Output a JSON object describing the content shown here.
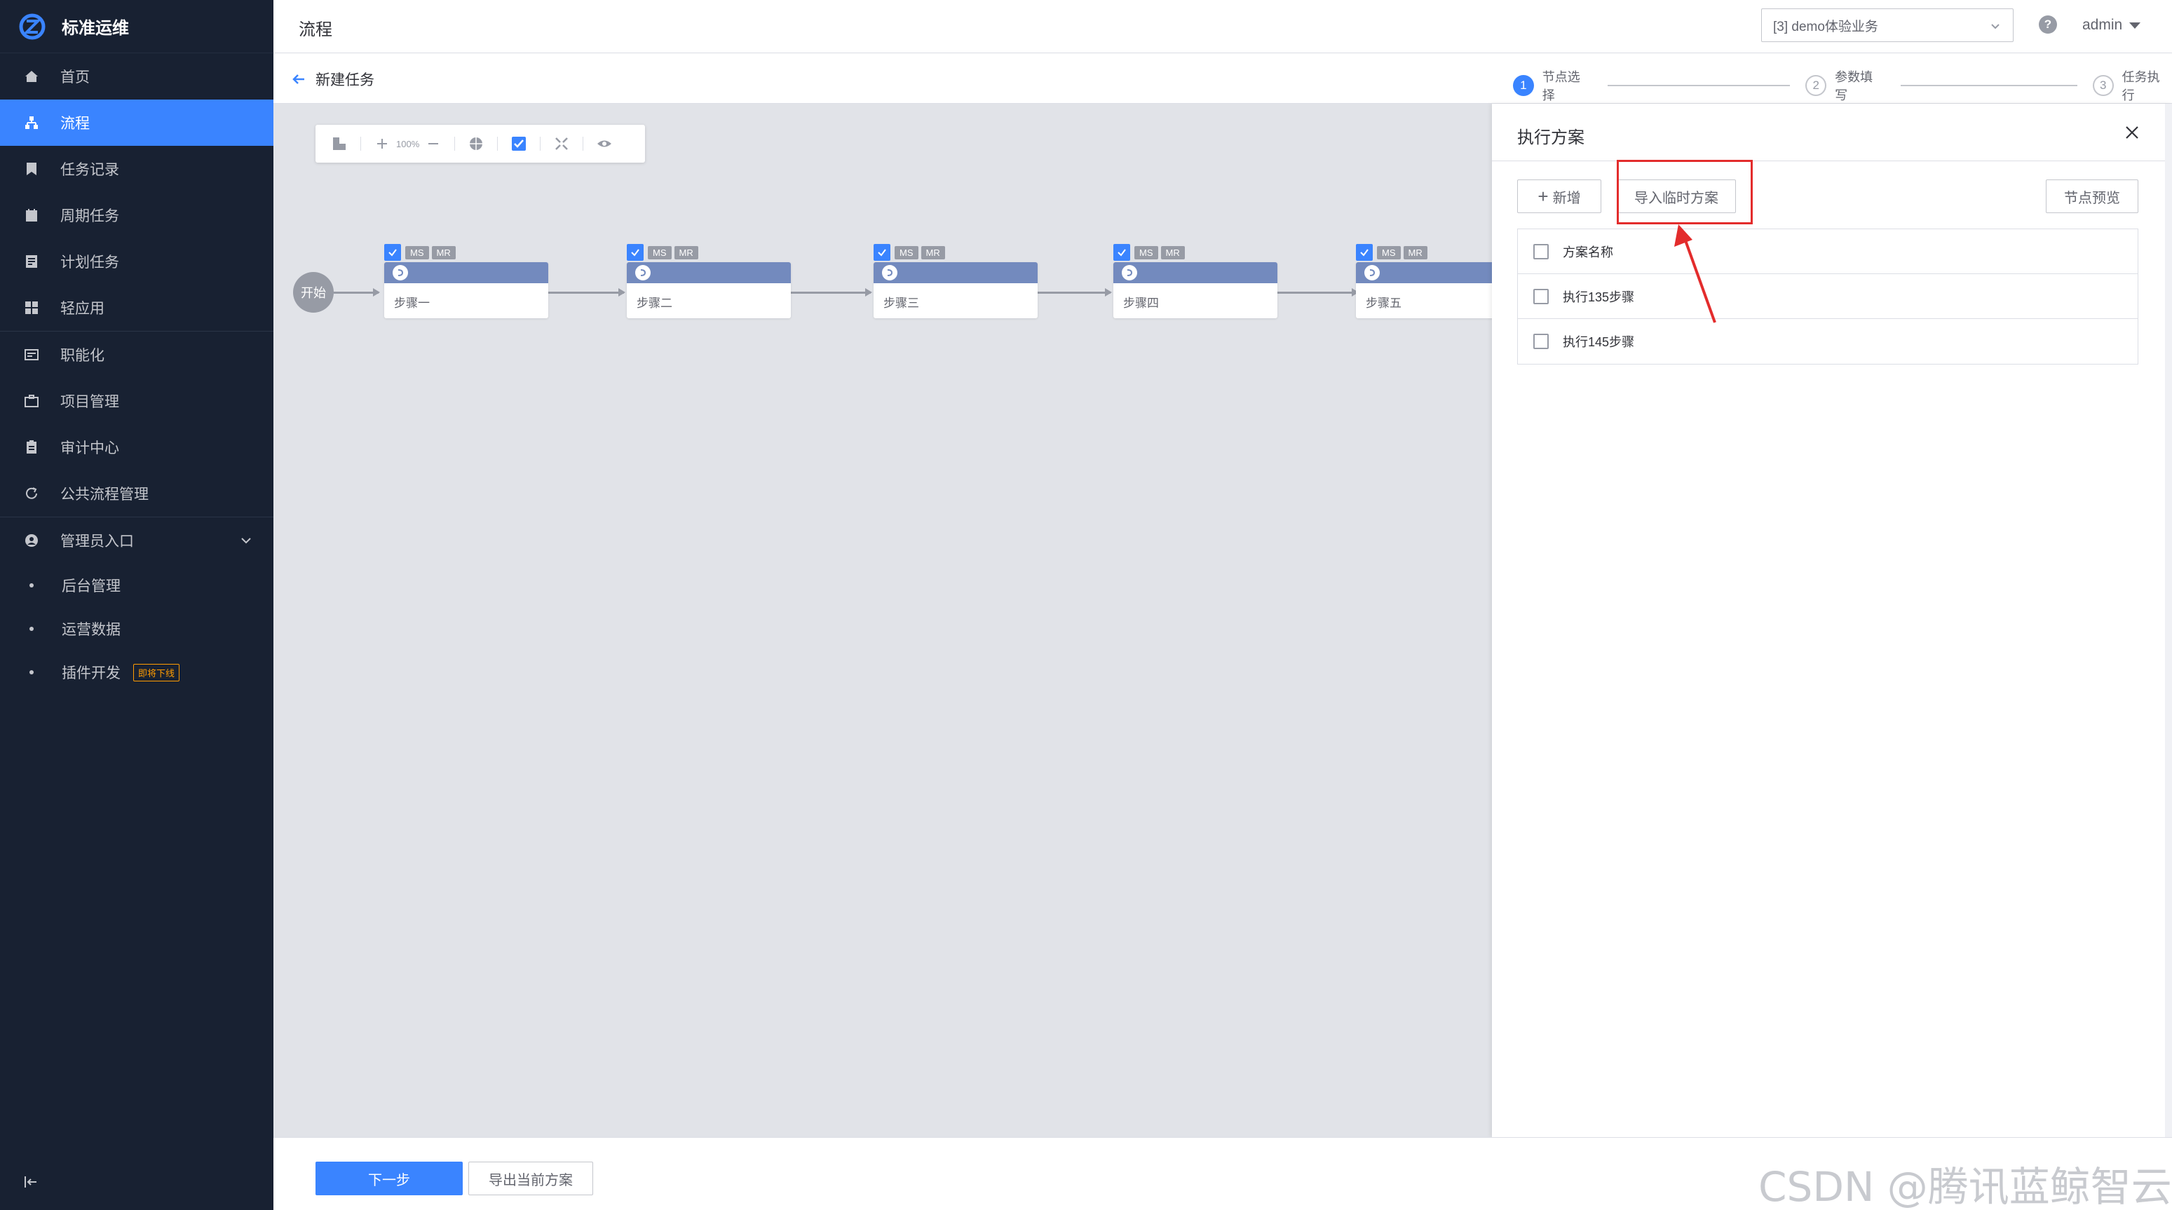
{
  "brand": {
    "title": "标准运维"
  },
  "sidebar": {
    "items": [
      {
        "label": "首页",
        "icon": "home-icon"
      },
      {
        "label": "流程",
        "icon": "flow-icon",
        "active": true
      },
      {
        "label": "任务记录",
        "icon": "bookmark-icon"
      },
      {
        "label": "周期任务",
        "icon": "calendar-icon"
      },
      {
        "label": "计划任务",
        "icon": "plan-icon"
      },
      {
        "label": "轻应用",
        "icon": "apps-icon"
      }
    ],
    "items2": [
      {
        "label": "职能化",
        "icon": "function-icon"
      },
      {
        "label": "项目管理",
        "icon": "briefcase-icon"
      },
      {
        "label": "审计中心",
        "icon": "clipboard-icon"
      },
      {
        "label": "公共流程管理",
        "icon": "refresh-icon"
      }
    ],
    "admin_group": {
      "label": "管理员入口",
      "icon": "user-circle-icon"
    },
    "admin_items": [
      {
        "label": "后台管理"
      },
      {
        "label": "运营数据"
      },
      {
        "label": "插件开发",
        "badge": "即将下线"
      }
    ]
  },
  "header": {
    "title": "流程",
    "business_select": "[3] demo体验业务",
    "user": "admin"
  },
  "subheader": {
    "back_label": "新建任务",
    "steps": [
      {
        "num": "1",
        "label": "节点选择",
        "active": true
      },
      {
        "num": "2",
        "label": "参数填写"
      },
      {
        "num": "3",
        "label": "任务执行"
      }
    ]
  },
  "canvas": {
    "zoom": "100%",
    "start_label": "开始",
    "tags": [
      "MS",
      "MR"
    ],
    "nodes": [
      {
        "label": "步骤一"
      },
      {
        "label": "步骤二"
      },
      {
        "label": "步骤三"
      },
      {
        "label": "步骤四"
      },
      {
        "label": "步骤五"
      }
    ]
  },
  "panel": {
    "title": "执行方案",
    "add_label": "新增",
    "import_label": "导入临时方案",
    "preview_label": "节点预览",
    "rows": [
      {
        "label": "方案名称"
      },
      {
        "label": "执行135步骤"
      },
      {
        "label": "执行145步骤"
      }
    ]
  },
  "footer": {
    "next_label": "下一步",
    "export_label": "导出当前方案"
  },
  "watermark": "CSDN @腾讯蓝鲸智云",
  "colors": {
    "accent": "#3a84ff",
    "sidebar_bg": "#182132",
    "node_header": "#738abe",
    "annotation": "#e32c2c"
  }
}
